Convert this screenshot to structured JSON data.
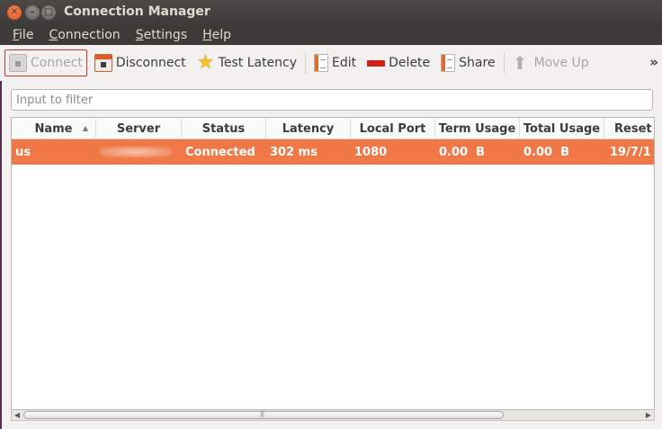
{
  "window": {
    "title": "Connection Manager"
  },
  "menubar": [
    {
      "label": "File",
      "mnemonic": "F",
      "rest": "ile"
    },
    {
      "label": "Connection",
      "mnemonic": "C",
      "rest": "onnection"
    },
    {
      "label": "Settings",
      "mnemonic": "S",
      "rest": "ettings"
    },
    {
      "label": "Help",
      "mnemonic": "H",
      "rest": "elp"
    }
  ],
  "toolbar": {
    "connect": "Connect",
    "disconnect": "Disconnect",
    "test_latency": "Test Latency",
    "edit": "Edit",
    "delete": "Delete",
    "share": "Share",
    "move_up": "Move Up",
    "overflow": "»"
  },
  "filter": {
    "placeholder": "Input to filter",
    "value": ""
  },
  "table": {
    "columns": [
      "Name",
      "Server",
      "Status",
      "Latency",
      "Local Port",
      "Term Usage",
      "Total Usage",
      "Reset D"
    ],
    "sorted_column": "Name",
    "sort_direction": "ascending",
    "rows": [
      {
        "name": "us",
        "server": "",
        "status": "Connected",
        "latency": "302 ms",
        "local_port": "1080",
        "term_usage": "0.00  B",
        "total_usage": "0.00  B",
        "reset_date": "19/7/1"
      }
    ]
  },
  "colors": {
    "selection": "#f07746",
    "titlebar": "#3c3b37",
    "close_button": "#df4a16"
  }
}
